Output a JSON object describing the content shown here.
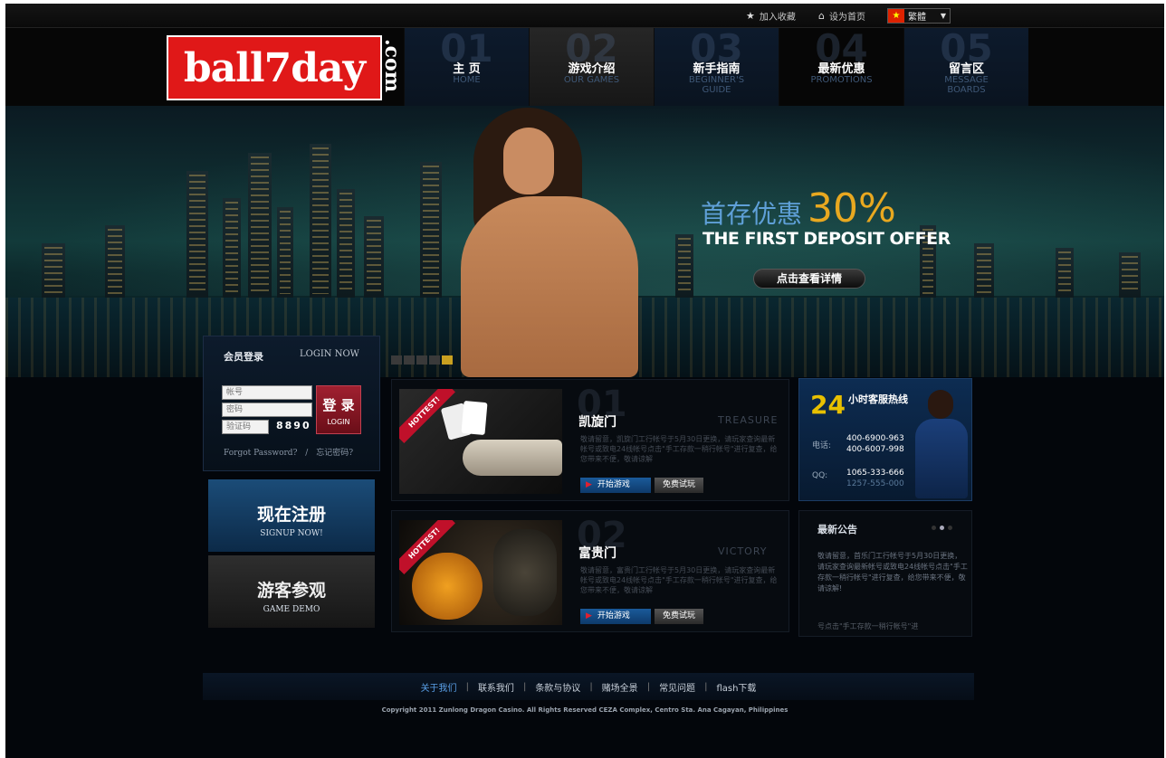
{
  "topbar": {
    "bookmark": "加入收藏",
    "homepage": "设为首页",
    "language": "繁體"
  },
  "logo": {
    "text": "ball7day",
    "suffix": ".com"
  },
  "nav": [
    {
      "num": "01",
      "cn": "主 页",
      "en": "HOME"
    },
    {
      "num": "02",
      "cn": "游戏介绍",
      "en": "OUR GAMES"
    },
    {
      "num": "03",
      "cn": "新手指南",
      "en": "BEGINNER'S GUIDE"
    },
    {
      "num": "04",
      "cn": "最新优惠",
      "en": "PROMOTIONS"
    },
    {
      "num": "05",
      "cn": "留言区",
      "en": "MESSAGE BOARDS"
    }
  ],
  "banner": {
    "offer_cn": "首存优惠",
    "offer_pct": "30%",
    "offer_en": "THE FIRST DEPOSIT OFFER",
    "details_button": "点击查看详情"
  },
  "login": {
    "title_cn": "会员登录",
    "title_en": "LOGIN NOW",
    "account_placeholder": "帐号",
    "password_placeholder": "密码",
    "code_placeholder": "验证码",
    "captcha": "8890",
    "button_cn": "登 录",
    "button_en": "LOGIN",
    "forgot_en": "Forgot Password?",
    "forgot_sep": "/",
    "forgot_cn": "忘记密码?"
  },
  "signup": {
    "cn": "现在注册",
    "en": "SIGNUP NOW!"
  },
  "demo": {
    "cn": "游客参观",
    "en": "GAME DEMO"
  },
  "games": [
    {
      "num": "01",
      "title": "凯旋门",
      "en": "TREASURE",
      "ribbon": "HOTTEST!",
      "desc": "敬请留意，凯旋门工行帐号于5月30日更换，请玩家查询最新帐号或致电24线帐号点击\"手工存款一稍行帐号\"进行复查，给您带来不便，敬请谅解",
      "play": "开始游戏",
      "try": "免费试玩"
    },
    {
      "num": "02",
      "title": "富贵门",
      "en": "VICTORY",
      "ribbon": "HOTTEST!",
      "desc": "敬请留意，富贵门工行帐号于5月30日更换，请玩家查询最新帐号或致电24线帐号点击\"手工存款一稍行帐号\"进行复查，给您带来不便，敬请谅解",
      "play": "开始游戏",
      "try": "免费试玩"
    }
  ],
  "hotline": {
    "big": "24",
    "title": "小时客服热线",
    "phone_label": "电话:",
    "phones": [
      "400-6900-963",
      "400-6007-998"
    ],
    "qq_label": "QQ:",
    "qqs": [
      "1065-333-666",
      "1257-555-000"
    ]
  },
  "news": {
    "title": "最新公告",
    "body": "敬请留意，首乐门工行帐号于5月30日更换，请玩家查询最新帐号或致电24线帐号点击\"手工存款一稍行帐号\"进行复查，给您带来不便，敬请谅解!",
    "more": "号点击\"手工存款一稍行帐号\"进"
  },
  "footer": {
    "links": [
      "关于我们",
      "联系我们",
      "条款与协议",
      "赌场全景",
      "常见问题",
      "flash下载"
    ],
    "copyright": "Copyright 2011 Zunlong Dragon Casino. All Rights Reserved CEZA Complex, Centro Sta. Ana Cagayan, Philippines"
  },
  "colors": {
    "accent_gold": "#e8a820",
    "nav_blue": "#0d1a2c",
    "login_red": "#a02030",
    "link_blue": "#5aa0e8"
  },
  "icons": [
    "star-icon",
    "home-icon",
    "flag-icon",
    "chevron-down-icon",
    "play-icon"
  ]
}
